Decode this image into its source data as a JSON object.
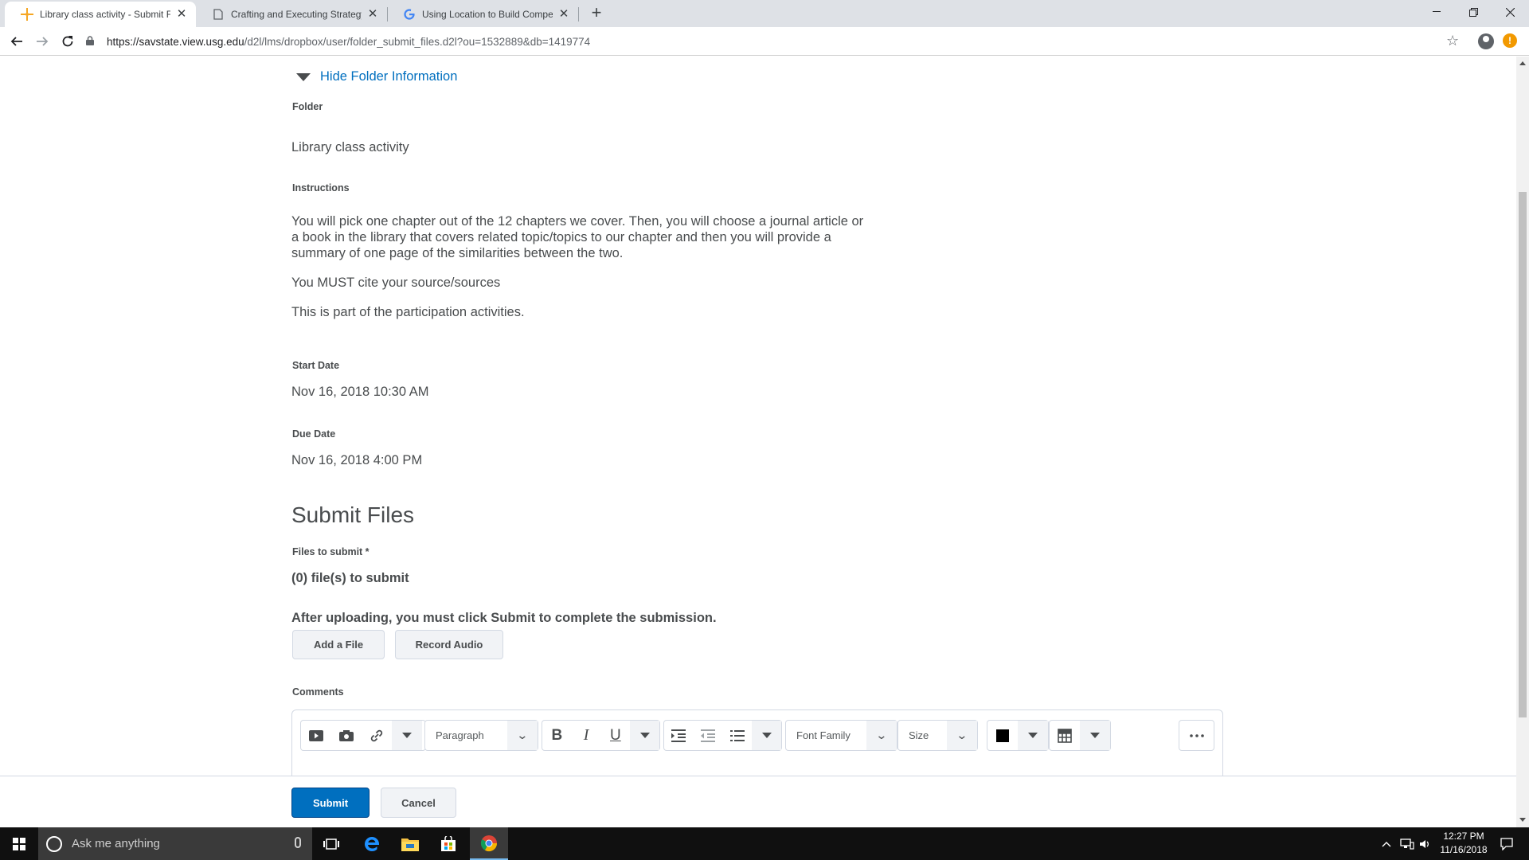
{
  "browser": {
    "tabs": [
      {
        "title": "Library class activity - Submit File",
        "icon": "d2l-star-icon"
      },
      {
        "title": "Crafting and Executing Strategy: C",
        "icon": "document-icon"
      },
      {
        "title": "Using Location to Build Competiti",
        "icon": "google-icon"
      }
    ],
    "url_host": "https://savstate.view.usg.edu",
    "url_path": "/d2l/lms/dropbox/user/folder_submit_files.d2l?ou=1532889&db=1419774"
  },
  "folder_info": {
    "toggle_label": "Hide Folder Information",
    "folder_label": "Folder",
    "folder_value": "Library class activity",
    "instructions_label": "Instructions",
    "instructions": [
      "You will pick one chapter out of the 12 chapters we cover. Then, you will choose a journal article or a book in the library that covers related topic/topics to our chapter and then you will provide a summary of one page of the similarities between the two.",
      "You MUST cite your source/sources",
      "This is part of the participation activities."
    ],
    "start_label": "Start Date",
    "start_value": "Nov 16, 2018 10:30 AM",
    "due_label": "Due Date",
    "due_value": "Nov 16, 2018 4:00 PM"
  },
  "submit": {
    "heading": "Submit Files",
    "files_label": "Files to submit *",
    "files_count": "(0) file(s) to submit",
    "after_upload": "After uploading, you must click Submit to complete the submission.",
    "add_file": "Add a File",
    "record_audio": "Record Audio",
    "comments_label": "Comments",
    "editor": {
      "block_format": "Paragraph",
      "font_family": "Font Family",
      "font_size": "Size",
      "text_color": "#000000"
    },
    "submit_button": "Submit",
    "cancel_button": "Cancel"
  },
  "taskbar": {
    "search_placeholder": "Ask me anything",
    "time": "12:27 PM",
    "date": "11/16/2018"
  }
}
